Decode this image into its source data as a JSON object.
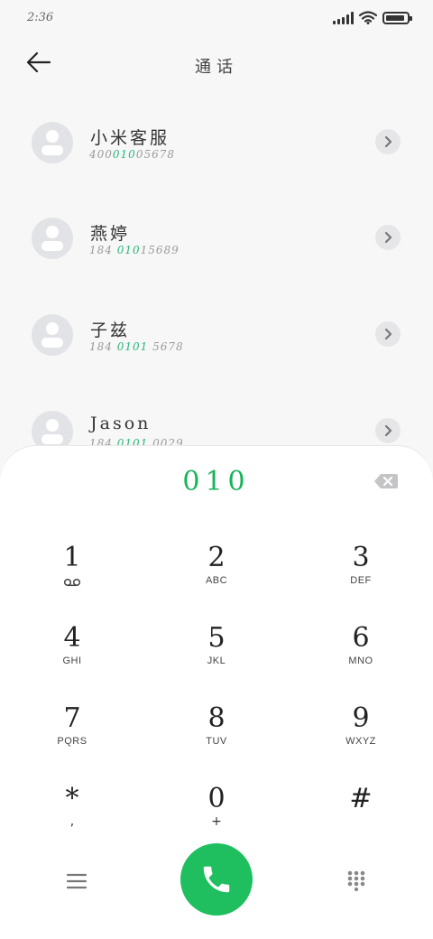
{
  "status_bar": {
    "time": "2:36",
    "battery_level": 0.9,
    "signal_bars": 5
  },
  "header": {
    "title": "通话"
  },
  "contacts": [
    {
      "name": "小米客服",
      "number_prefix": "400",
      "number_highlight": "010",
      "number_suffix": "05678"
    },
    {
      "name": "燕婷",
      "number_prefix": "184 ",
      "number_highlight": "010",
      "number_suffix": "15689"
    },
    {
      "name": "子兹",
      "number_prefix": "184 ",
      "number_highlight": "0101",
      "number_suffix": " 5678"
    },
    {
      "name": "Jason",
      "number_prefix": "184 ",
      "number_highlight": "0101",
      "number_suffix": " 0029"
    }
  ],
  "dialpad": {
    "dialed_number": "010",
    "keys": [
      {
        "digit": "1",
        "letters": "",
        "sub": ""
      },
      {
        "digit": "2",
        "letters": "ABC",
        "sub": ""
      },
      {
        "digit": "3",
        "letters": "DEF",
        "sub": ""
      },
      {
        "digit": "4",
        "letters": "GHI",
        "sub": ""
      },
      {
        "digit": "5",
        "letters": "JKL",
        "sub": ""
      },
      {
        "digit": "6",
        "letters": "MNO",
        "sub": ""
      },
      {
        "digit": "7",
        "letters": "PQRS",
        "sub": ""
      },
      {
        "digit": "8",
        "letters": "TUV",
        "sub": ""
      },
      {
        "digit": "9",
        "letters": "WXYZ",
        "sub": ""
      },
      {
        "digit": "*",
        "letters": "",
        "sub": ","
      },
      {
        "digit": "0",
        "letters": "",
        "sub": "+"
      },
      {
        "digit": "#",
        "letters": "",
        "sub": ""
      }
    ]
  },
  "icons": {
    "back": "arrow-left-icon",
    "detail": "chevron-right-icon",
    "backspace": "backspace-icon",
    "voicemail": "voicemail-icon",
    "menu": "menu-icon",
    "call": "phone-icon",
    "keypad": "dialpad-icon"
  },
  "colors": {
    "accent_green": "#19b35a",
    "call_button": "#1fbf5f",
    "highlight_digits": "#2bb67a"
  }
}
